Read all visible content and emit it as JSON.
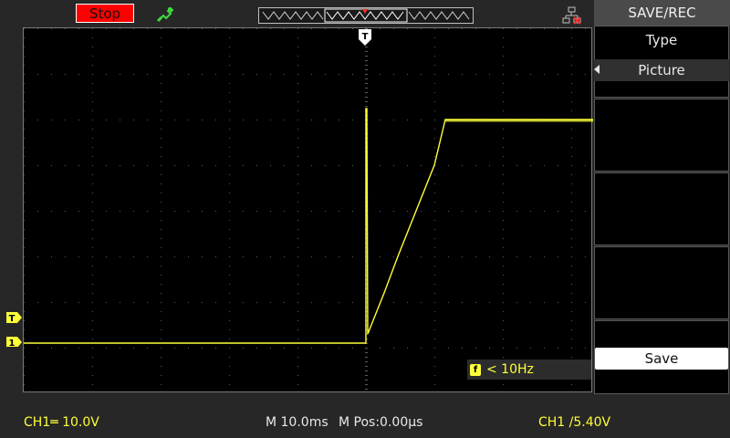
{
  "status": {
    "run_state": "Stop",
    "colors": {
      "run_state_bg": "#ff0000",
      "channel1": "#ffff3a"
    }
  },
  "display": {
    "trigger_position_marker": "T",
    "trigger_level_marker": "T",
    "channel_marker": "1",
    "frequency_counter": "< 10Hz",
    "frequency_icon": "f"
  },
  "menu": {
    "title": "SAVE/REC",
    "type_label": "Type",
    "type_value": "Picture",
    "save_button": "Save"
  },
  "bottom": {
    "ch1_scale": "CH1═ 10.0V",
    "timebase": "M 10.0ms",
    "mpos": "M Pos:0.00µs",
    "trigger": "CH1 /5.40V"
  },
  "icons": {
    "probe": "probe-icon",
    "network": "network-disconnected-icon",
    "menu_arrow": "triangle-left-icon"
  }
}
